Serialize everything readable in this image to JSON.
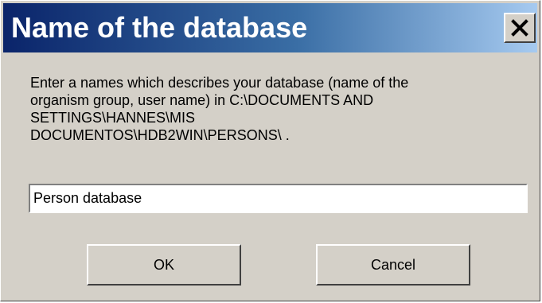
{
  "dialog": {
    "title": "Name of the database",
    "close_icon": "close-icon",
    "message": "Enter a names which describes your database (name of the\norganism group, user name) in C:\\DOCUMENTS AND\nSETTINGS\\HANNES\\MIS\nDOCUMENTOS\\HDB2WIN\\PERSONS\\ .",
    "name_value": "Person database",
    "ok_label": "OK",
    "cancel_label": "Cancel"
  },
  "colors": {
    "title_gradient_start": "#0a246a",
    "title_gradient_end": "#a6caf0",
    "dialog_face": "#d4d0c8"
  }
}
